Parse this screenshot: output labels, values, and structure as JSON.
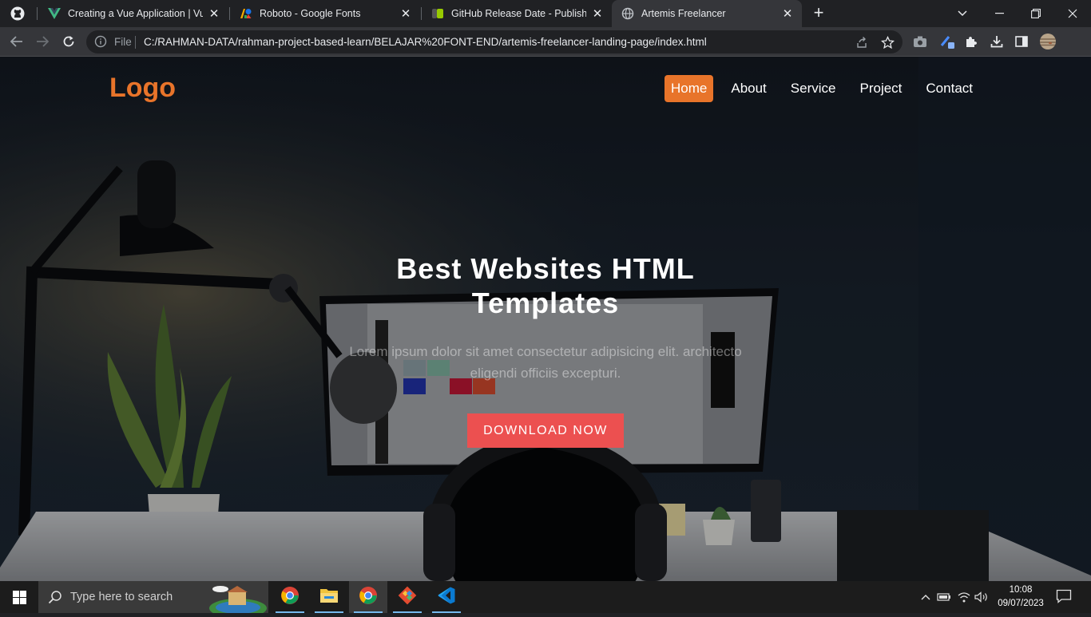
{
  "browser": {
    "tabs": [
      {
        "title": "Creating a Vue Application | Vue.js",
        "icon": "vue-icon",
        "active": false
      },
      {
        "title": "Roboto - Google Fonts",
        "icon": "google-fonts-icon",
        "active": false
      },
      {
        "title": "GitHub Release Date - Published",
        "icon": "shields-icon",
        "active": false
      },
      {
        "title": "Artemis Freelancer",
        "icon": "globe-icon",
        "active": true
      }
    ],
    "address": {
      "scheme_label": "File",
      "url": "C:/RAHMAN-DATA/rahman-project-based-learn/BELAJAR%20FONT-END/artemis-freelancer-landing-page/index.html"
    }
  },
  "page": {
    "logo": "Logo",
    "nav": [
      {
        "label": "Home",
        "active": true
      },
      {
        "label": "About",
        "active": false
      },
      {
        "label": "Service",
        "active": false
      },
      {
        "label": "Project",
        "active": false
      },
      {
        "label": "Contact",
        "active": false
      }
    ],
    "hero": {
      "title": "Best Websites HTML Templates",
      "subtitle": "Lorem ipsum dolor sit amet consectetur adipisicing elit. architecto eligendi officiis excepturi.",
      "cta": "DOWNLOAD NOW"
    },
    "colors": {
      "accent": "#e8742a",
      "cta": "#ec5050"
    }
  },
  "taskbar": {
    "search_placeholder": "Type here to search",
    "apps": [
      "chrome-icon",
      "file-explorer-icon",
      "chrome-icon",
      "git-icon",
      "vscode-icon"
    ],
    "time": "10:08",
    "date": "09/07/2023"
  }
}
